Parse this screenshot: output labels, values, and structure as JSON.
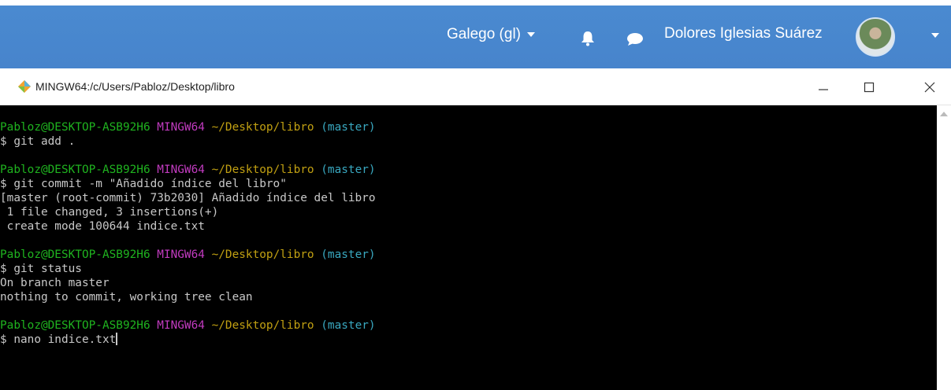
{
  "browser_header": {
    "language_label": "Galego (gl)",
    "user_name": "Dolores Iglesias Suárez"
  },
  "window": {
    "title": "MINGW64:/c/Users/Pabloz/Desktop/libro"
  },
  "terminal": {
    "prompt": {
      "user_host": "Pabloz@DESKTOP-ASB92H6",
      "shell": "MINGW64",
      "path": "~/Desktop/libro",
      "branch": "(master)"
    },
    "blocks": [
      {
        "command": "$ git add .",
        "output": []
      },
      {
        "command": "$ git commit -m \"Añadido índice del libro\"",
        "output": [
          "[master (root-commit) 73b2030] Añadido índice del libro",
          " 1 file changed, 3 insertions(+)",
          " create mode 100644 indice.txt"
        ]
      },
      {
        "command": "$ git status",
        "output": [
          "On branch master",
          "nothing to commit, working tree clean"
        ]
      },
      {
        "command": "$ nano indice.txt",
        "output": []
      }
    ]
  },
  "colors": {
    "appbar": "#4784cc",
    "terminal_bg": "#000000",
    "prompt_user": "#1fb31f",
    "prompt_shell": "#c13bbf",
    "prompt_path": "#c1a012",
    "prompt_branch": "#39a8c0"
  }
}
